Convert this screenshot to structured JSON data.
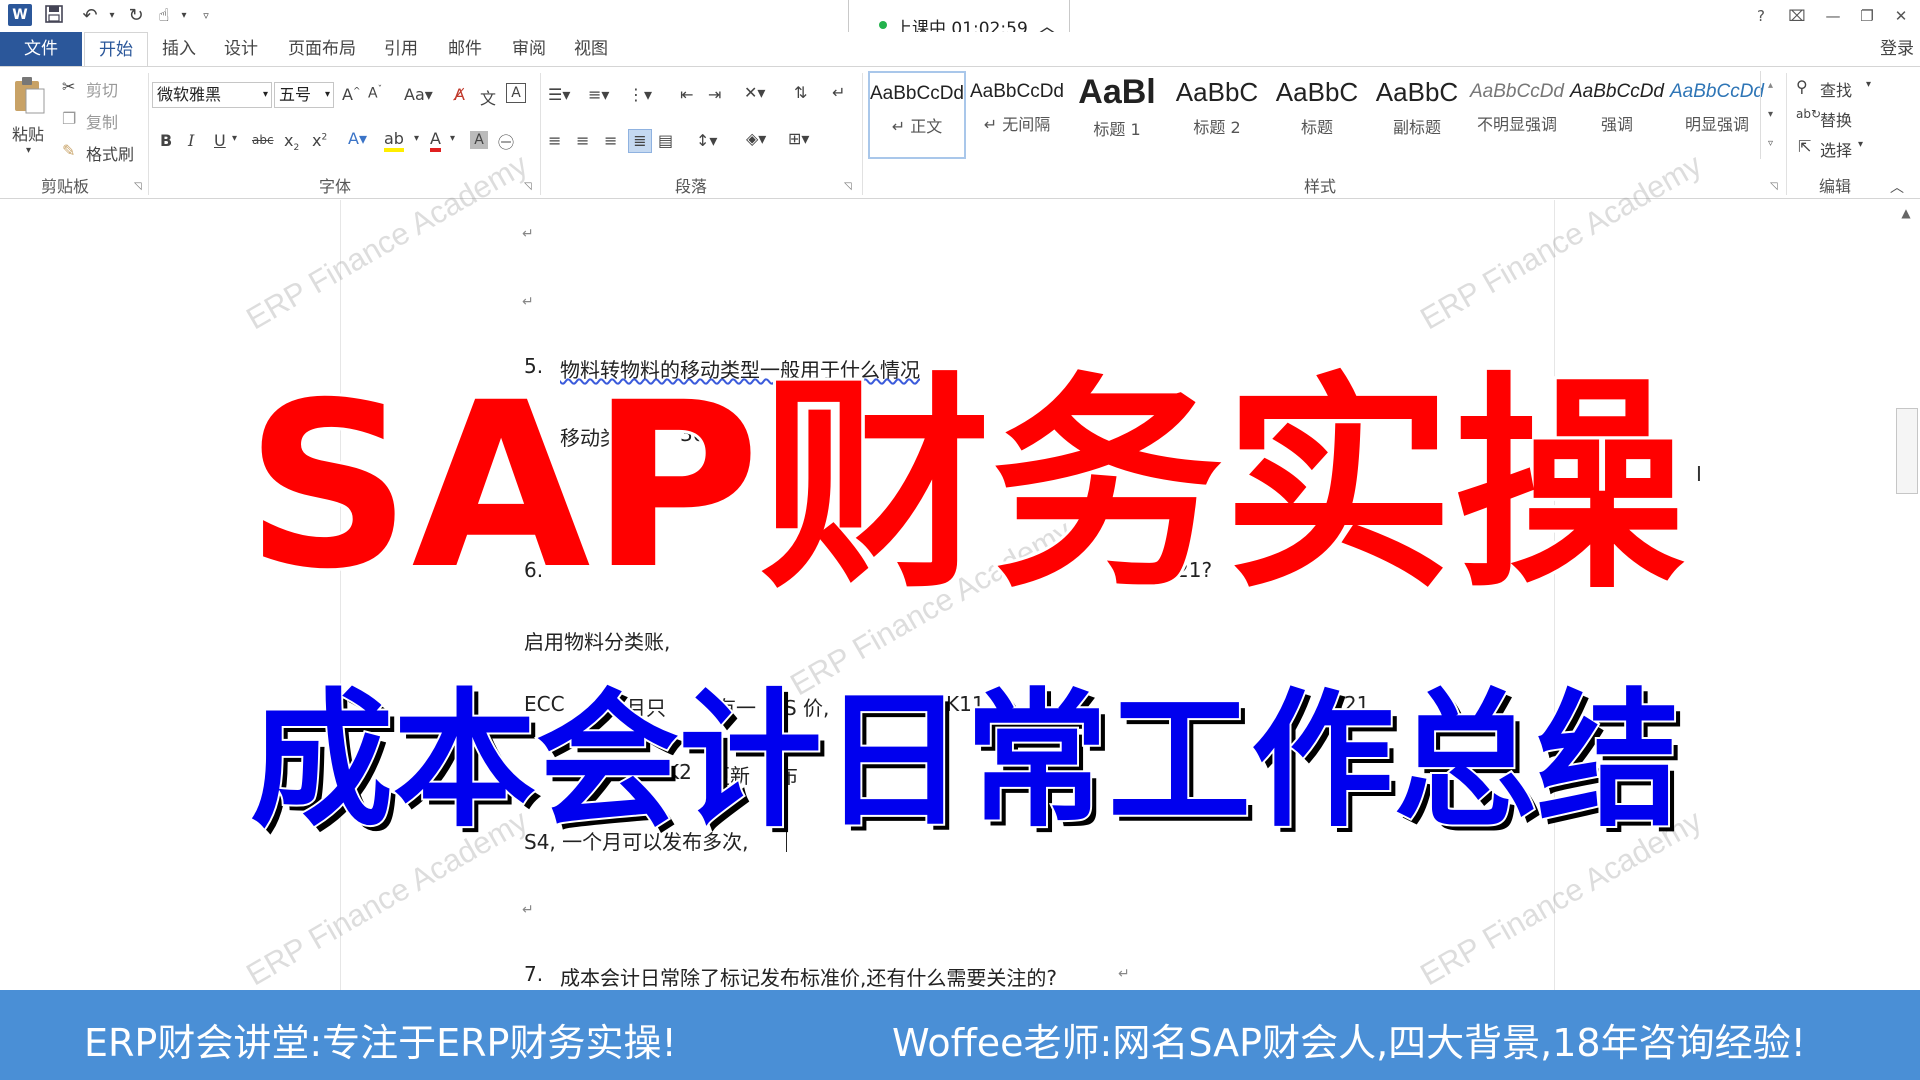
{
  "titlebar": {
    "word_logo": "W",
    "help": "?",
    "min": "—",
    "restore": "❐",
    "close": "✕",
    "ribbon_opt": "⌧"
  },
  "timer": {
    "text": "上课中 01:02:59",
    "chevron": "︿"
  },
  "tabs": [
    {
      "label": "文件"
    },
    {
      "label": "开始"
    },
    {
      "label": "插入"
    },
    {
      "label": "设计"
    },
    {
      "label": "页面布局"
    },
    {
      "label": "引用"
    },
    {
      "label": "邮件"
    },
    {
      "label": "审阅"
    },
    {
      "label": "视图"
    }
  ],
  "login": "登录",
  "clipboard": {
    "paste": "粘贴",
    "cut": "剪切",
    "copy": "复制",
    "painter": "格式刷",
    "label": "剪贴板"
  },
  "font": {
    "name": "微软雅黑",
    "size": "五号",
    "label": "字体"
  },
  "paragraph": {
    "label": "段落"
  },
  "styles": {
    "label": "样式",
    "items": [
      {
        "sample": "AaBbCcDd",
        "name": "↵ 正文"
      },
      {
        "sample": "AaBbCcDd",
        "name": "↵ 无间隔"
      },
      {
        "sample": "AaBl",
        "name": "标题 1"
      },
      {
        "sample": "AaBbC",
        "name": "标题 2"
      },
      {
        "sample": "AaBbC",
        "name": "标题"
      },
      {
        "sample": "AaBbC",
        "name": "副标题"
      },
      {
        "sample": "AaBbCcDd",
        "name": "不明显强调"
      },
      {
        "sample": "AaBbCcDd",
        "name": "强调"
      },
      {
        "sample": "AaBbCcDd",
        "name": "明显强调"
      }
    ]
  },
  "editing": {
    "find": "查找",
    "replace": "替换",
    "select": "选择",
    "label": "编辑"
  },
  "doc": {
    "line_q5_num": "5.",
    "line_q5": "物料转物料的移动类型一般用于什么情况",
    "line_move": "移动类",
    "line_move_num": "309,",
    "line_q6_num": "6.",
    "line_q6_end": "21?",
    "line_ledger": "启用物料分类账,",
    "line_ecc": "ECC",
    "line_ecc_mid": "个月只",
    "line_ecc_mid2": "有一",
    "line_ecc_s": "S 价,",
    "line_ecc_k": "K11",
    "line_ecc_tail": "R21",
    "line_update_k": "K2",
    "line_update": "更新",
    "line_update_tail": "布",
    "line_s4": "S4, 一个月可以发布多次,",
    "line_q7_num": "7.",
    "line_q7": "成本会计日常除了标记发布标准价,还有什么需要关注的?"
  },
  "watermark": "ERP Finance Academy",
  "overlay": {
    "title": "SAP财务实操",
    "subtitle": "成本会计日常工作总结"
  },
  "footer": {
    "left": "ERP财会讲堂:专注于ERP财务实操!",
    "right": "Woffee老师:网名SAP财会人,四大背景,18年咨询经验!"
  },
  "colors": {
    "title_red": "#ff0000",
    "subtitle_blue": "#0000ee",
    "footer_bg": "#4a8fd6",
    "word_blue": "#2b579a"
  }
}
